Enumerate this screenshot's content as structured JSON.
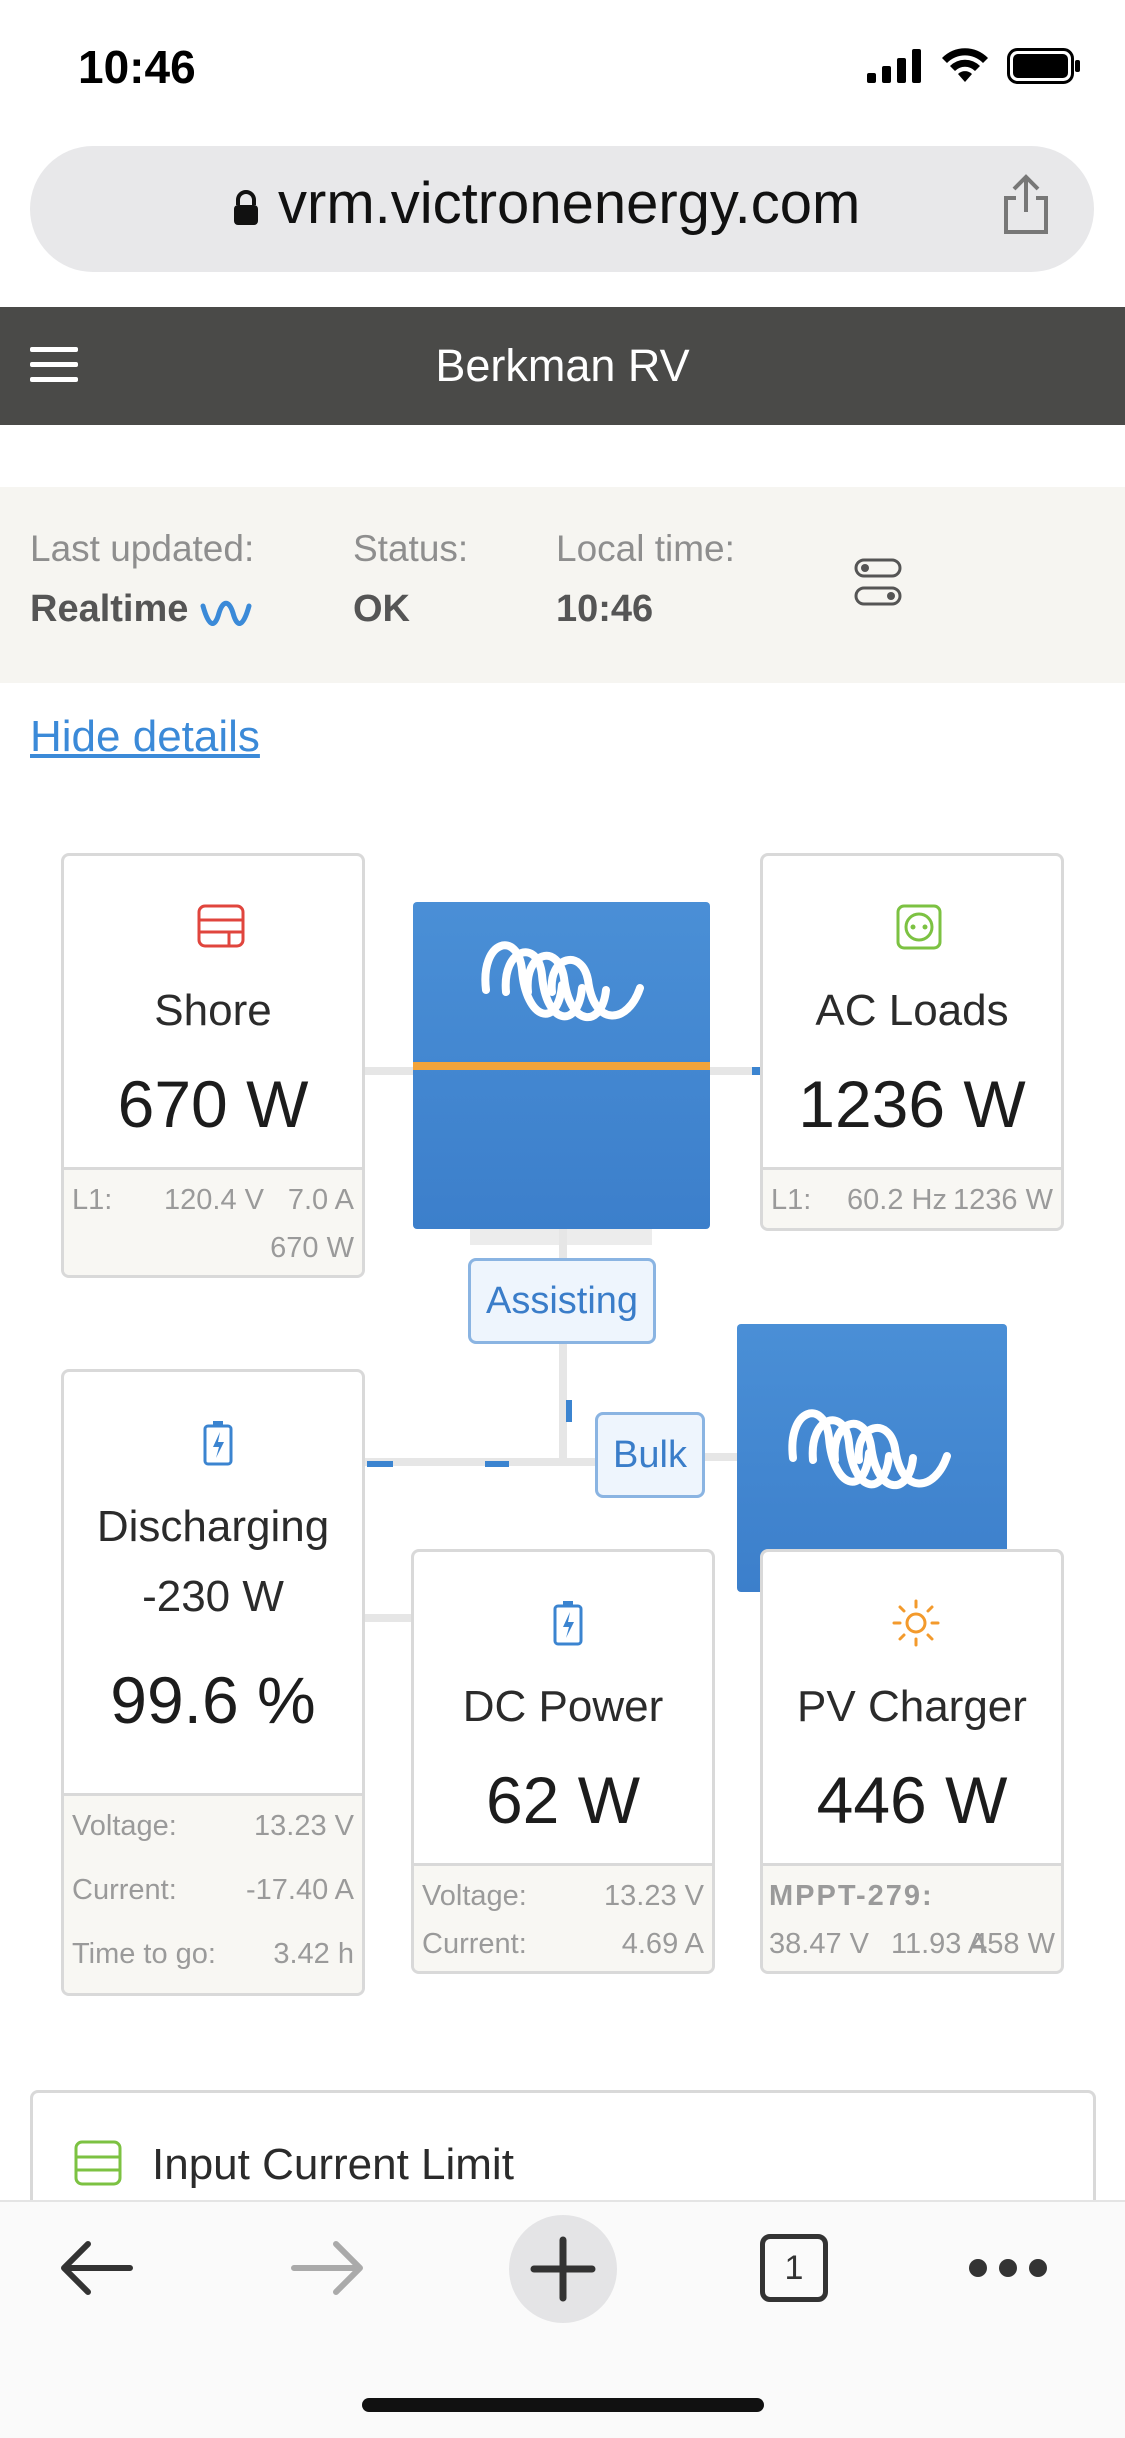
{
  "status_bar": {
    "time": "10:46"
  },
  "browser": {
    "url": "vrm.victronenergy.com",
    "tab_count": "1"
  },
  "header": {
    "title": "Berkman RV"
  },
  "info": {
    "last_updated_label": "Last updated:",
    "last_updated_value": "Realtime",
    "status_label": "Status:",
    "status_value": "OK",
    "local_time_label": "Local time:",
    "local_time_value": "10:46"
  },
  "hide_details": "Hide details",
  "shore": {
    "title": "Shore",
    "power": "670 W",
    "l1_label": "L1:",
    "l1_voltage": "120.4 V",
    "l1_current": "7.0 A",
    "l1_power": "670 W"
  },
  "ac_loads": {
    "title": "AC Loads",
    "power": "1236 W",
    "l1_label": "L1:",
    "l1_freq": "60.2 Hz",
    "l1_power": "1236 W"
  },
  "inverter": {
    "state": "Assisting"
  },
  "charger": {
    "state": "Bulk"
  },
  "battery": {
    "state": "Discharging",
    "power": "-230 W",
    "soc": "99.6 %",
    "voltage_label": "Voltage:",
    "voltage": "13.23 V",
    "current_label": "Current:",
    "current": "-17.40 A",
    "ttg_label": "Time to go:",
    "ttg": "3.42 h"
  },
  "dc_power": {
    "title": "DC Power",
    "power": "62 W",
    "voltage_label": "Voltage:",
    "voltage": "13.23 V",
    "current_label": "Current:",
    "current": "4.69 A"
  },
  "pv_charger": {
    "title": "PV Charger",
    "power": "446 W",
    "device": "MPPT-279:",
    "voltage": "38.47 V",
    "current": "11.93 A",
    "pv_power": "458 W"
  },
  "input_current_limit": {
    "title": "Input Current Limit"
  },
  "colors": {
    "accent": "#3b8ad8",
    "header": "#4a4a48",
    "flow": "#3b84d0",
    "inverter_line": "#f3a43a",
    "shore_icon": "#e0453d",
    "ac_icon": "#7cc242",
    "pv_icon": "#f39a2c"
  }
}
